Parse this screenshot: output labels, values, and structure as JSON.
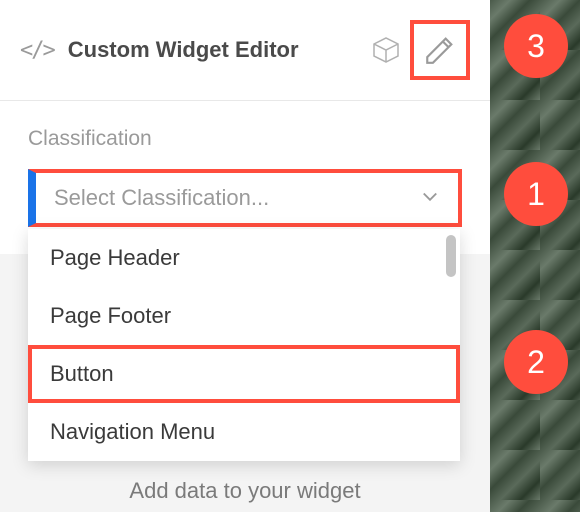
{
  "header": {
    "title": "Custom Widget Editor"
  },
  "classification": {
    "label": "Classification",
    "placeholder": "Select Classification...",
    "options": [
      {
        "label": "Page Header"
      },
      {
        "label": "Page Footer"
      },
      {
        "label": "Button"
      },
      {
        "label": "Navigation Menu"
      }
    ]
  },
  "footer": {
    "add_data": "Add data to your widget"
  },
  "callouts": {
    "c1": "1",
    "c2": "2",
    "c3": "3"
  }
}
